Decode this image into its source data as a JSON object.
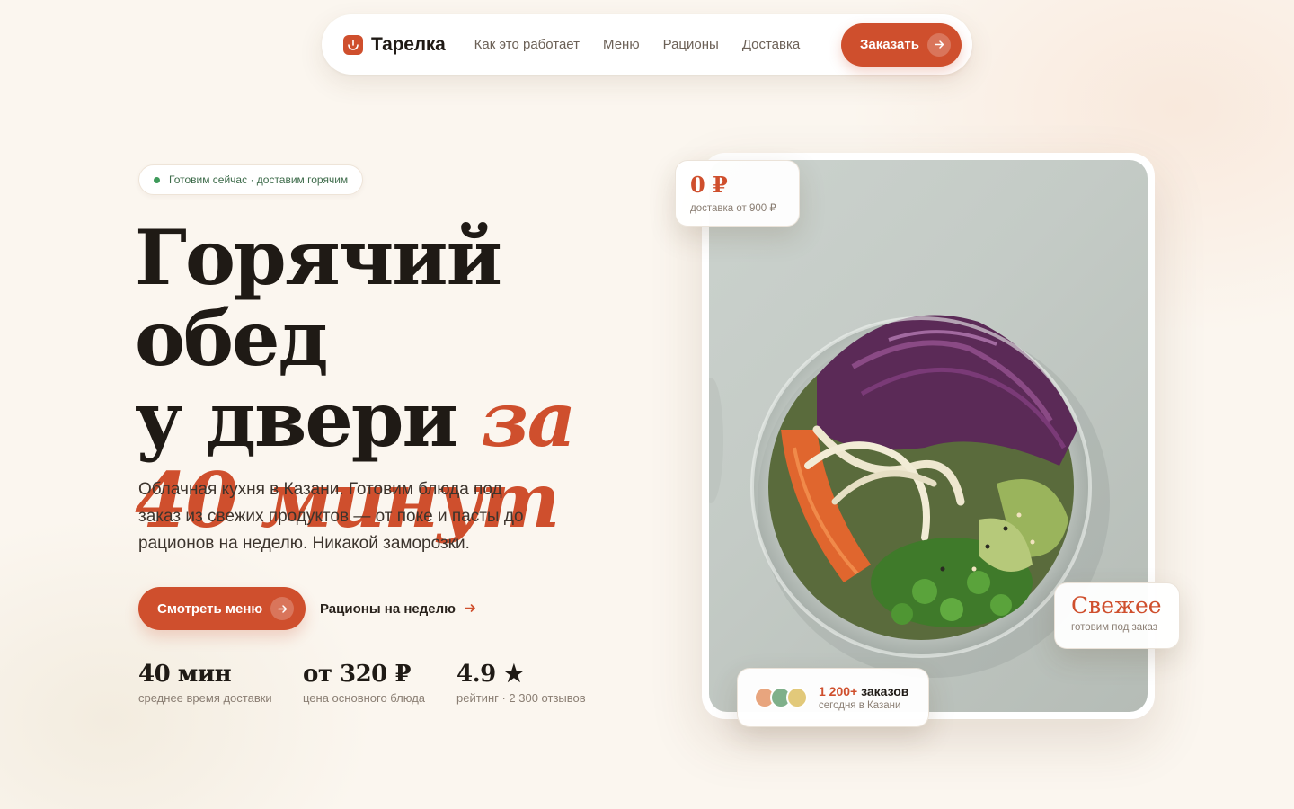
{
  "nav": {
    "brand": "Тарелка",
    "links": [
      "Как это работает",
      "Меню",
      "Рационы",
      "Доставка"
    ],
    "cta": "Заказать"
  },
  "hero": {
    "badge": "Готовим сейчас · доставим горячим",
    "headline_line1": "Горячий обед",
    "headline_line2": "у двери ",
    "headline_accent": "за 40 минут",
    "subtitle": "Облачная кухня в Казани. Готовим блюда под заказ из свежих продуктов — от поке и пасты до рационов на неделю. Никакой заморозки.",
    "primary_button": "Смотреть меню",
    "secondary_link": "Рационы на неделю"
  },
  "stats": [
    {
      "value": "40 мин",
      "label": "среднее время доставки"
    },
    {
      "value": "от 320 ₽",
      "label": "цена основного блюда"
    },
    {
      "value": "4.9 ★",
      "label": "рейтинг · 2 300 отзывов"
    }
  ],
  "cards": {
    "delivery": {
      "big": "0 ₽",
      "small": "доставка от 900 ₽"
    },
    "fresh": {
      "big": "Свежее",
      "small": "готовим под заказ"
    },
    "orders": {
      "count": "1 200+",
      "suffix": " заказов",
      "sub": "сегодня в Казани"
    }
  },
  "colors": {
    "accent": "#cf4f2d",
    "background": "#fbf6ef",
    "badge_dot": "#3e9a5a",
    "avatars": [
      "#e8a57e",
      "#7fb08a",
      "#e2c97a"
    ]
  },
  "icons": {
    "brand": "bowl-icon",
    "arrow": "arrow-right-icon"
  }
}
